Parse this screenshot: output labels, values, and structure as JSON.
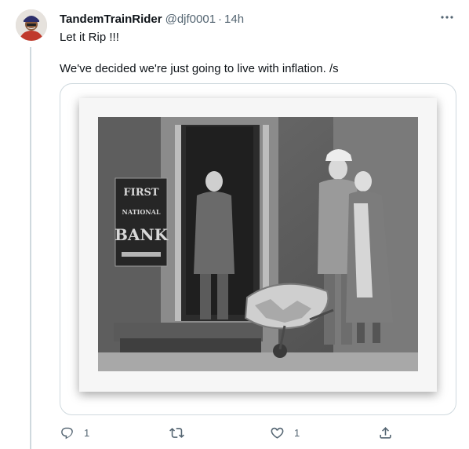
{
  "tweet": {
    "display_name": "TandemTrainRider",
    "handle": "@djf0001",
    "separator": "·",
    "time": "14h",
    "text_lines": [
      "Let it Rip !!!",
      "We've decided we're just going to live with inflation.  /s"
    ],
    "photo": {
      "sign_text": [
        "FIRST",
        "NATIONAL",
        "BANK"
      ]
    }
  },
  "actions": {
    "reply": {
      "icon": "reply-icon",
      "count": "1"
    },
    "retweet": {
      "icon": "retweet-icon",
      "count": ""
    },
    "like": {
      "icon": "heart-icon",
      "count": "1"
    },
    "share": {
      "icon": "share-icon",
      "count": ""
    }
  },
  "colors": {
    "secondary_text": "#536471",
    "border": "#cfd9de"
  }
}
